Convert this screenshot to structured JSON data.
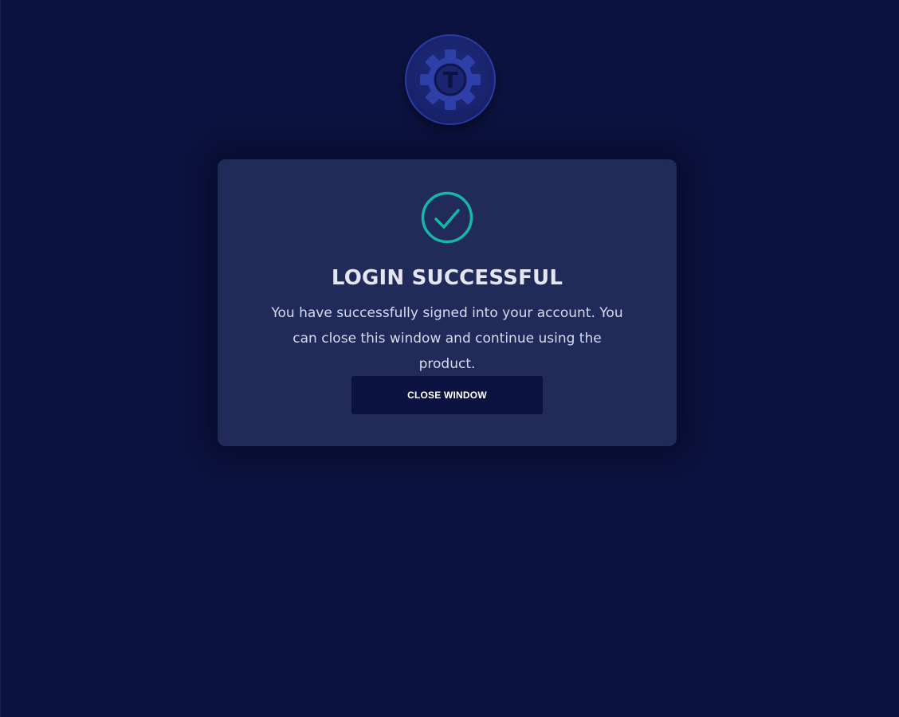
{
  "logo": {
    "icon": "gear-t-logo-icon",
    "letter": "T"
  },
  "dialog": {
    "status_icon": "check-circle-icon",
    "title": "LOGIN SUCCESSFUL",
    "message": "You have successfully signed into your account. You can close this window and continue using the product.",
    "button_label": "CLOSE WINDOW"
  },
  "colors": {
    "background": "#0c1340",
    "card": "#212b5a",
    "accent": "#14b8a6",
    "logo_gear": "#2f3fa8",
    "button": "#0c1340"
  }
}
